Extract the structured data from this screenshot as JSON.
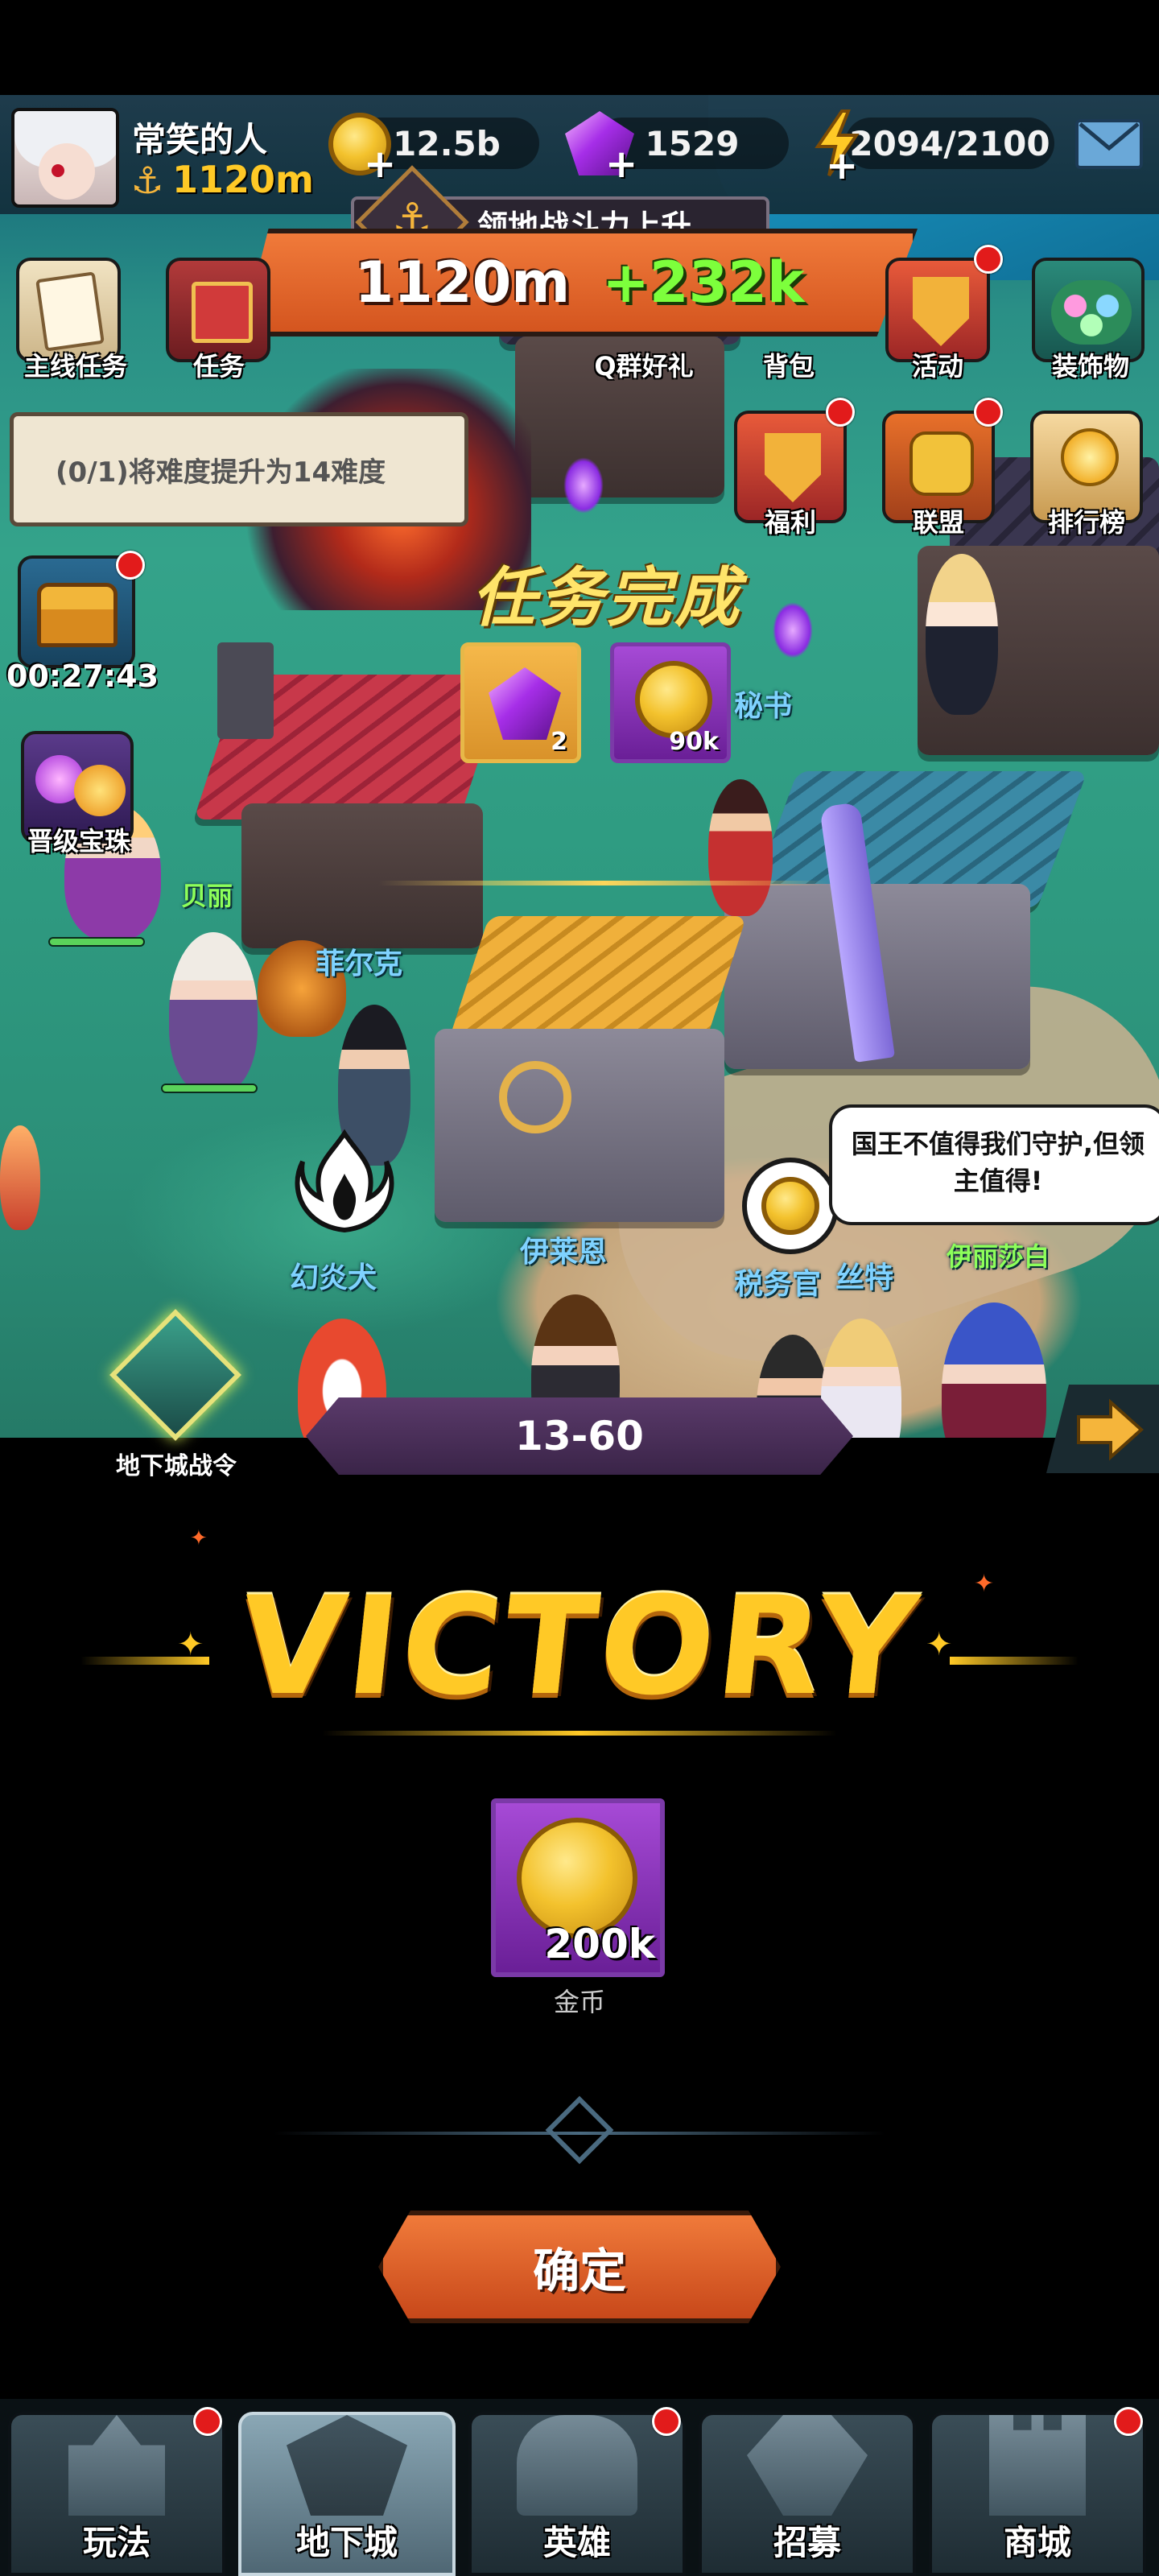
{
  "player": {
    "name": "常笑的人",
    "power": "1120m"
  },
  "resources": {
    "gold": "12.5b",
    "gems": "1529",
    "energy": "2094/2100"
  },
  "power_banner": {
    "title": "领地战斗力上升",
    "value": "1120m",
    "delta": "+232k"
  },
  "menu": {
    "main_quest": "主线任务",
    "quest": "任务",
    "qq_group": "Q群好礼",
    "backpack": "背包",
    "activity": "活动",
    "decorations": "装饰物",
    "welfare": "福利",
    "alliance": "联盟",
    "ranking": "排行榜",
    "upgrade_orb": "晋级宝珠",
    "dungeon_pass": "地下城战令"
  },
  "task_tip": "(0/1)将难度提升为14难度",
  "chest_timer": "00:27:43",
  "task_complete": {
    "title": "任务完成",
    "rewards": [
      {
        "icon": "gem-icon",
        "count": "2"
      },
      {
        "icon": "gold-coin-icon",
        "count": "90k"
      }
    ]
  },
  "npcs": {
    "beili": "贝丽",
    "feierke": "菲尔克",
    "huanyanquan": "幻炎犬",
    "yilaien": "伊莱恩",
    "shuiwuguan": "税务官",
    "silte": "丝特",
    "mishu": "秘书",
    "yilishabai": "伊丽莎白"
  },
  "speech_bubble": "国王不值得我们守护,但领主值得!",
  "stage": "13-60",
  "victory": {
    "title": "VICTORY",
    "reward_amount": "200k",
    "reward_name": "金币",
    "confirm": "确定"
  },
  "bottom_nav": [
    {
      "label": "玩法",
      "badge": true,
      "active": false
    },
    {
      "label": "地下城",
      "badge": false,
      "active": true
    },
    {
      "label": "英雄",
      "badge": true,
      "active": false
    },
    {
      "label": "招募",
      "badge": false,
      "active": false
    },
    {
      "label": "商城",
      "badge": true,
      "active": false
    }
  ],
  "colors": {
    "accent_orange": "#e2662e",
    "gold": "#ffc926",
    "gem_purple": "#a62ee8",
    "badge_red": "#e21b1b",
    "green_delta": "#7dff3c"
  }
}
